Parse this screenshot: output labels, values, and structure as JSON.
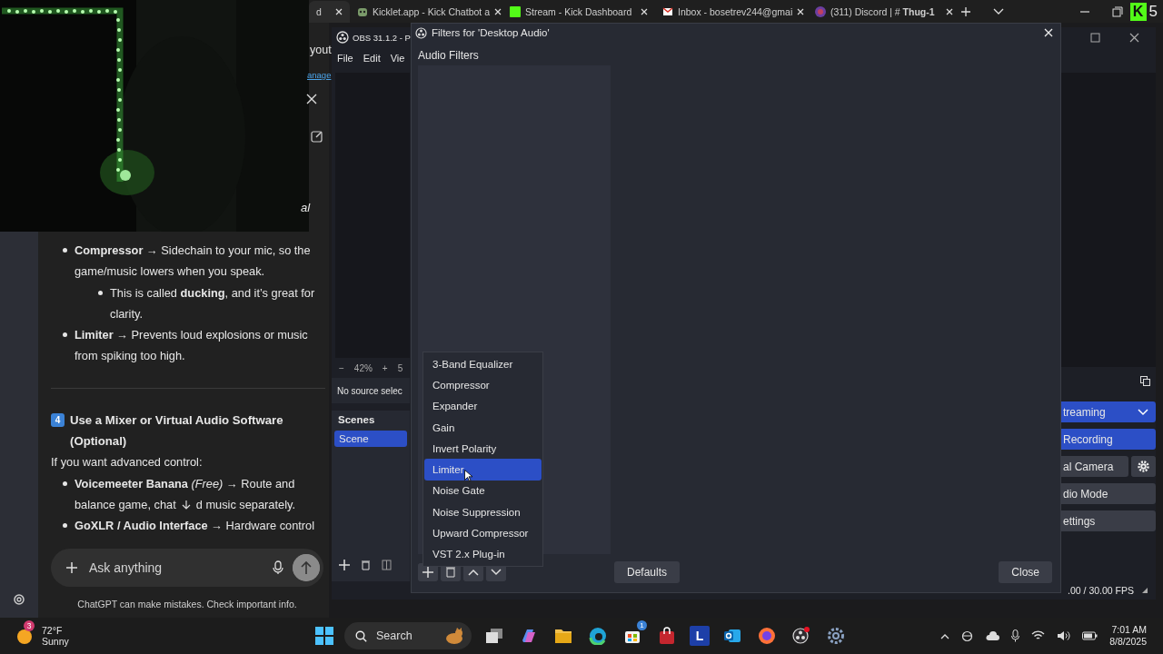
{
  "browser": {
    "tabs": [
      {
        "label": "d",
        "selected": true
      },
      {
        "label": "Kicklet.app - Kick Chatbot a",
        "selected": false
      },
      {
        "label": "Stream - Kick Dashboard",
        "selected": false
      },
      {
        "label": "Inbox - bosetrev244@gmai",
        "selected": false
      },
      {
        "label": "(311) Discord | #",
        "suffix": "Thug-1",
        "selected": false
      }
    ],
    "extension": {
      "letter": "K",
      "count": "5"
    }
  },
  "chat": {
    "cut_text": "al",
    "link_fragment": "yout",
    "manage_fragment": "anage",
    "items": [
      {
        "text": "**Compressor** → Sidechain to your mic, so the game/music lowers when you speak.",
        "children": [
          {
            "text": "This is called **ducking**, and it’s great for clarity."
          }
        ]
      },
      {
        "text": "**Limiter** → Prevents loud explosions or music from spiking too high."
      }
    ],
    "heading": {
      "number": "4",
      "text": "Use a Mixer or Virtual Audio Software (Optional)"
    },
    "intro": "If you want advanced control:",
    "items2": [
      {
        "text": "**Voicemeeter Banana** *(Free)* → Route and",
        "line2": "balance game, chat",
        "tail": "d music separately."
      },
      {
        "text": "**GoXLR / Audio Interface** → Hardware control"
      }
    ],
    "input": {
      "placeholder": "Ask anything"
    },
    "footer": "ChatGPT can make mistakes. Check important info."
  },
  "obs": {
    "title": "OBS 31.1.2 - P",
    "menu": [
      "File",
      "Edit",
      "Vie"
    ],
    "zoom": {
      "minus": "−",
      "value": "42%",
      "plus": "+",
      "cut": "5"
    },
    "no_source": "No source selec",
    "scenes": {
      "title": "Scenes",
      "items": [
        {
          "label": "Scene",
          "selected": true
        }
      ]
    },
    "controls": [
      {
        "label": "treaming",
        "kind": "primary",
        "dropdown": true,
        "gear": false
      },
      {
        "label": "Recording",
        "kind": "primary",
        "dropdown": false,
        "gear": false
      },
      {
        "label": "al Camera",
        "kind": "normal",
        "dropdown": false,
        "gear": true
      },
      {
        "label": "dio Mode",
        "kind": "normal",
        "dropdown": false,
        "gear": false
      },
      {
        "label": "ettings",
        "kind": "normal",
        "dropdown": false,
        "gear": false
      }
    ],
    "fps": ".00 / 30.00 FPS"
  },
  "dialog": {
    "title": "Filters for 'Desktop Audio'",
    "section": "Audio Filters",
    "menu": [
      {
        "label": "3-Band Equalizer",
        "selected": false
      },
      {
        "label": "Compressor",
        "selected": false
      },
      {
        "label": "Expander",
        "selected": false
      },
      {
        "label": "Gain",
        "selected": false
      },
      {
        "label": "Invert Polarity",
        "selected": false
      },
      {
        "label": "Limiter",
        "selected": true
      },
      {
        "label": "Noise Gate",
        "selected": false
      },
      {
        "label": "Noise Suppression",
        "selected": false
      },
      {
        "label": "Upward Compressor",
        "selected": false
      },
      {
        "label": "VST 2.x Plug-in",
        "selected": false
      }
    ],
    "defaults_button": "Defaults",
    "close_button": "Close"
  },
  "taskbar": {
    "weather": {
      "badge": "3",
      "temp": "72°F",
      "condition": "Sunny"
    },
    "search": {
      "placeholder": "Search"
    },
    "store_badge": "1",
    "launcher_letter": "L",
    "time": "7:01 AM",
    "date": "8/8/2025"
  }
}
